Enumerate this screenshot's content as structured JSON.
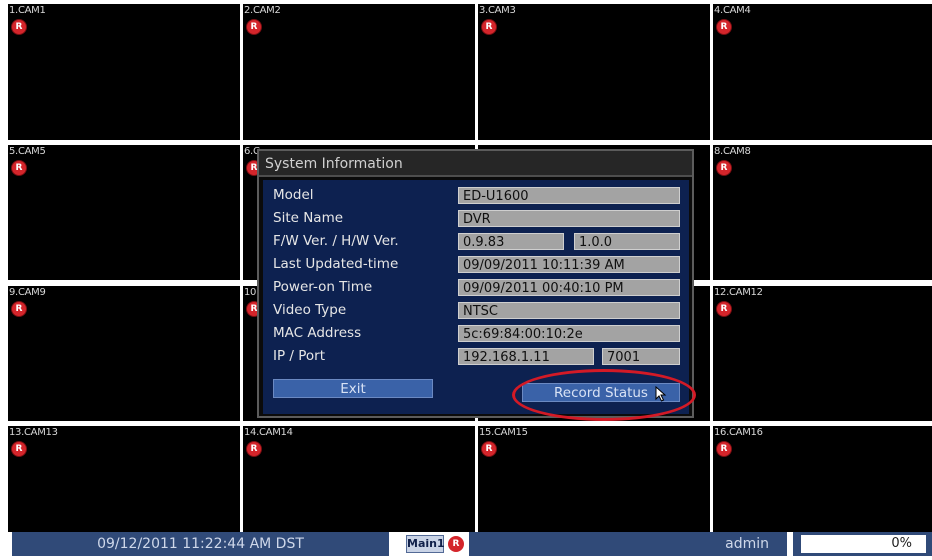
{
  "cameras": [
    {
      "label": "1.CAM1"
    },
    {
      "label": "2.CAM2"
    },
    {
      "label": "3.CAM3"
    },
    {
      "label": "4.CAM4"
    },
    {
      "label": "5.CAM5"
    },
    {
      "label": "6.C"
    },
    {
      "label": ""
    },
    {
      "label": "8.CAM8"
    },
    {
      "label": "9.CAM9"
    },
    {
      "label": "10"
    },
    {
      "label": ""
    },
    {
      "label": "12.CAM12"
    },
    {
      "label": "13.CAM13"
    },
    {
      "label": "14.CAM14"
    },
    {
      "label": "15.CAM15"
    },
    {
      "label": "16.CAM16"
    }
  ],
  "rec_badge": "R",
  "dialog": {
    "title": "System Information",
    "rows": [
      {
        "label": "Model",
        "value": "ED-U1600"
      },
      {
        "label": "Site Name",
        "value": "DVR"
      },
      {
        "label": "F/W Ver. / H/W Ver.",
        "value": "0.9.83",
        "value2": "1.0.0"
      },
      {
        "label": "Last Updated-time",
        "value": "09/09/2011 10:11:39 AM"
      },
      {
        "label": "Power-on Time",
        "value": "09/09/2011 00:40:10 PM"
      },
      {
        "label": "Video Type",
        "value": "NTSC"
      },
      {
        "label": "MAC Address",
        "value": "5c:69:84:00:10:2e"
      },
      {
        "label": "IP / Port",
        "value": "192.168.1.11",
        "value2": "7001"
      }
    ],
    "exit_label": "Exit",
    "record_status_label": "Record Status"
  },
  "status_bar": {
    "datetime": "09/12/2011 11:22:44 AM DST",
    "display": "Main1",
    "user": "admin",
    "percent": "0%"
  },
  "colors": {
    "dialog_body": "#0d2150",
    "button": "#3a62a8",
    "highlight": "#d31a26",
    "rec": "#d4252b"
  }
}
